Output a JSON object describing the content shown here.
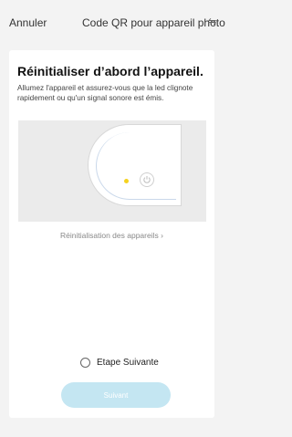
{
  "header": {
    "cancel_label": "Annuler",
    "mode_label": "Code QR pour appareil photo",
    "swap_icon": "swap-arrows-icon"
  },
  "card": {
    "title": "Réinitialiser d’abord l’appareil.",
    "description": "Allumez l'appareil et assurez-vous que la led clignote rapidement ou qu'un signal sonore est émis.",
    "led_color": "#f5d21f",
    "reset_link_label": "Réinitialisation des appareils",
    "reset_link_chevron": "›",
    "confirm_label": "Etape Suivante",
    "confirm_checked": false,
    "next_button_label": "Suivant",
    "next_button_color": "#c4e6f2"
  }
}
